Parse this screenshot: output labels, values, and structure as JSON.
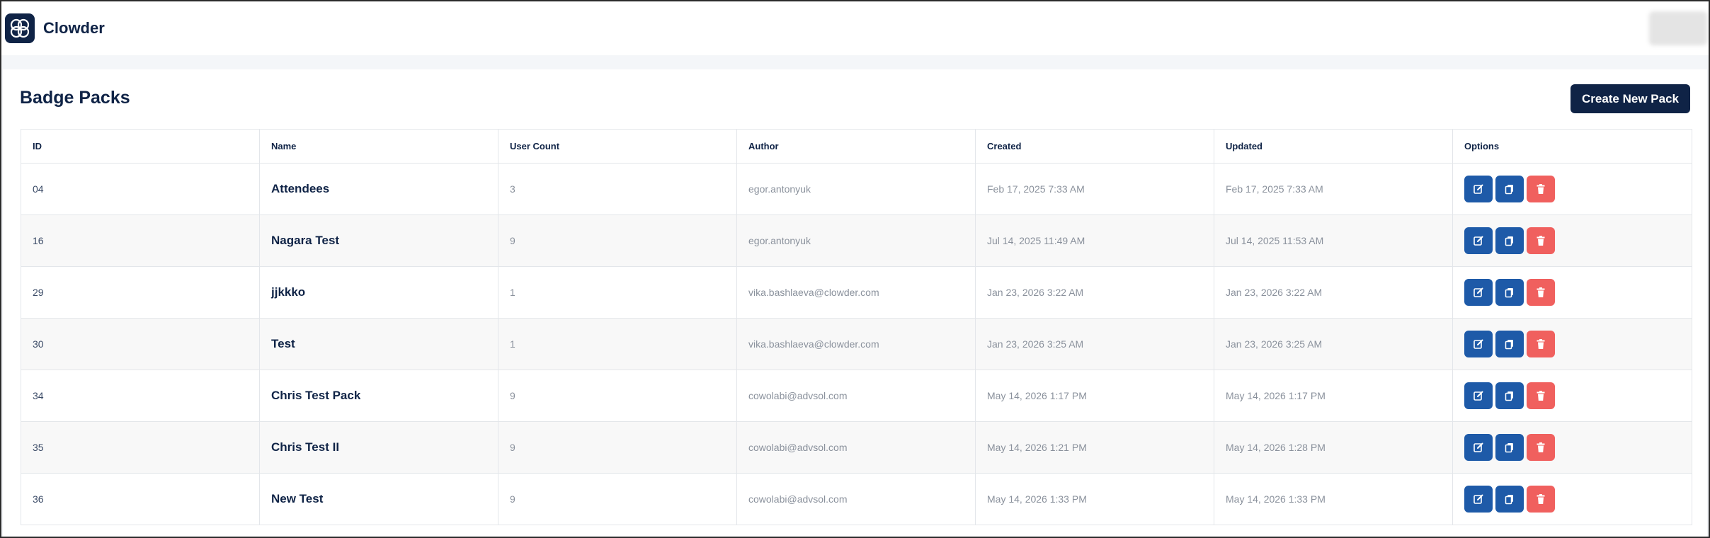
{
  "app": {
    "brand": "Clowder"
  },
  "page": {
    "title": "Badge Packs",
    "create_button_label": "Create New Pack"
  },
  "table": {
    "columns": [
      "ID",
      "Name",
      "User Count",
      "Author",
      "Created",
      "Updated",
      "Options"
    ],
    "rows": [
      {
        "id": "04",
        "name": "Attendees",
        "user_count": "3",
        "author": "egor.antonyuk",
        "created": "Feb 17, 2025 7:33 AM",
        "updated": "Feb 17, 2025 7:33 AM"
      },
      {
        "id": "16",
        "name": "Nagara Test",
        "user_count": "9",
        "author": "egor.antonyuk",
        "created": "Jul 14, 2025 11:49 AM",
        "updated": "Jul 14, 2025 11:53 AM"
      },
      {
        "id": "29",
        "name": "jjkkko",
        "user_count": "1",
        "author": "vika.bashlaeva@clowder.com",
        "created": "Jan 23, 2026 3:22 AM",
        "updated": "Jan 23, 2026 3:22 AM"
      },
      {
        "id": "30",
        "name": "Test",
        "user_count": "1",
        "author": "vika.bashlaeva@clowder.com",
        "created": "Jan 23, 2026 3:25 AM",
        "updated": "Jan 23, 2026 3:25 AM"
      },
      {
        "id": "34",
        "name": "Chris Test Pack",
        "user_count": "9",
        "author": "cowolabi@advsol.com",
        "created": "May 14, 2026 1:17 PM",
        "updated": "May 14, 2026 1:17 PM"
      },
      {
        "id": "35",
        "name": "Chris Test II",
        "user_count": "9",
        "author": "cowolabi@advsol.com",
        "created": "May 14, 2026 1:21 PM",
        "updated": "May 14, 2026 1:28 PM"
      },
      {
        "id": "36",
        "name": "New Test",
        "user_count": "9",
        "author": "cowolabi@advsol.com",
        "created": "May 14, 2026 1:33 PM",
        "updated": "May 14, 2026 1:33 PM"
      }
    ],
    "row_actions": [
      "edit-icon",
      "copy-icon",
      "trash-icon"
    ]
  },
  "colors": {
    "brand_navy": "#0f2346",
    "action_blue": "#1e5aa8",
    "danger_red": "#f0605e"
  }
}
